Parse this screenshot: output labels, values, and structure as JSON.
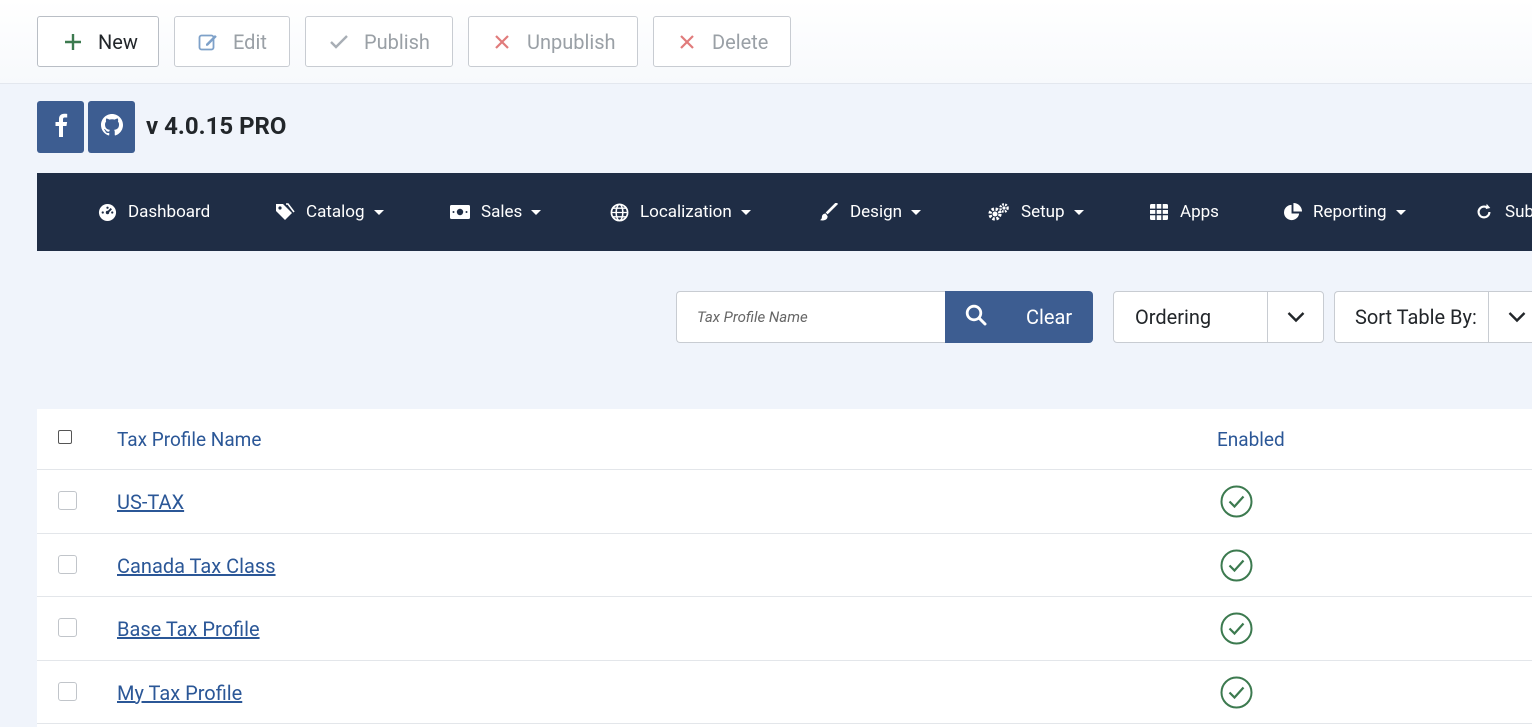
{
  "toolbar": {
    "new_label": "New",
    "edit_label": "Edit",
    "publish_label": "Publish",
    "unpublish_label": "Unpublish",
    "delete_label": "Delete"
  },
  "brand": {
    "version": "v 4.0.15 PRO",
    "social_icons": [
      "facebook-icon",
      "github-icon"
    ]
  },
  "nav": {
    "items": [
      {
        "label": "Dashboard",
        "icon": "dashboard-icon"
      },
      {
        "label": "Catalog",
        "icon": "tags-icon"
      },
      {
        "label": "Sales",
        "icon": "money-icon"
      },
      {
        "label": "Localization",
        "icon": "globe-icon"
      },
      {
        "label": "Design",
        "icon": "brush-icon"
      },
      {
        "label": "Setup",
        "icon": "cogs-icon"
      },
      {
        "label": "Apps",
        "icon": "grid-icon"
      },
      {
        "label": "Reporting",
        "icon": "pie-chart-icon"
      },
      {
        "label": "Sub",
        "icon": "refresh-icon"
      }
    ]
  },
  "filters": {
    "search_placeholder": "Tax Profile Name",
    "clear_label": "Clear",
    "ordering_label": "Ordering",
    "sort_label": "Sort Table By:"
  },
  "table": {
    "columns": [
      "Tax Profile Name",
      "Enabled"
    ],
    "rows": [
      {
        "name": "US-TAX",
        "enabled": true
      },
      {
        "name": "Canada Tax Class",
        "enabled": true
      },
      {
        "name": "Base Tax Profile",
        "enabled": true
      },
      {
        "name": "My Tax Profile",
        "enabled": true
      }
    ]
  },
  "colors": {
    "primary": "#3d5d91",
    "nav_bg": "#1f2d45",
    "link": "#2b5797",
    "success": "#3c7a4f",
    "danger": "#d9534f"
  }
}
